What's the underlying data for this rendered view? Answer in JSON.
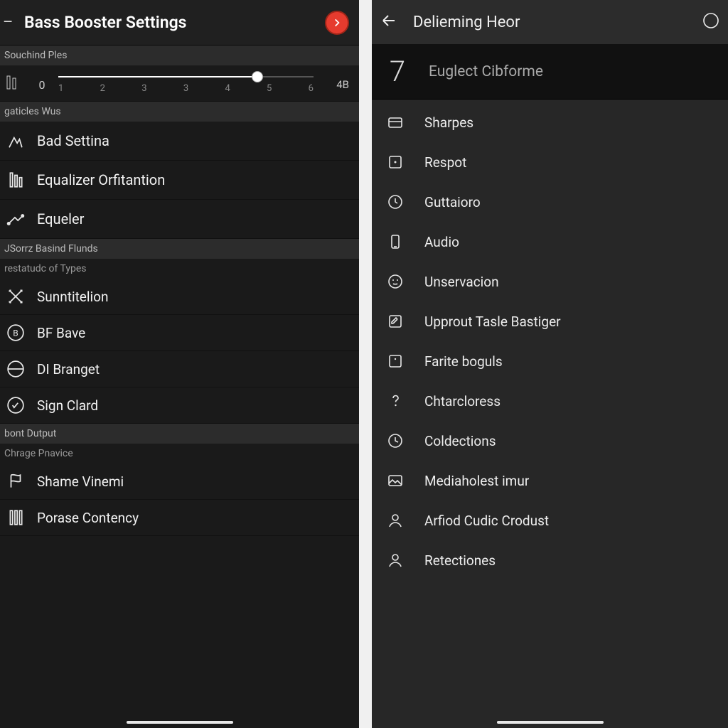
{
  "left": {
    "title": "Bass Booster Settings",
    "section1": "Souchind Ples",
    "slider": {
      "min": "0",
      "end": "4B",
      "ticks": [
        "1",
        "2",
        "3",
        "3",
        "4",
        "5",
        "6"
      ],
      "fill_pct": 78
    },
    "section2": "gaticles Wus",
    "items2": [
      {
        "label": "Bad Settina"
      },
      {
        "label": "Equalizer Orfitantion"
      },
      {
        "label": "Equeler"
      }
    ],
    "section3": "JSorrz Basind Flunds",
    "sub3": "restatudc of Types",
    "items3": [
      {
        "label": "Sunntitelion"
      },
      {
        "label": "BF Bave"
      },
      {
        "label": "DI Branget"
      },
      {
        "label": "Sign Clard"
      }
    ],
    "section4": "bont Dutput",
    "sub4": "Chrage Pnavice",
    "items4": [
      {
        "label": "Shame Vinemi"
      },
      {
        "label": "Porase Contency"
      }
    ]
  },
  "right": {
    "title": "Delieming Heor",
    "big_num": "7",
    "big_label": "Euglect Cibforme",
    "items": [
      {
        "label": "Sharpes",
        "icon": "card"
      },
      {
        "label": "Respot",
        "icon": "box-dot"
      },
      {
        "label": "Guttaioro",
        "icon": "clock-arrow"
      },
      {
        "label": "Audio",
        "icon": "phone"
      },
      {
        "label": "Unservacion",
        "icon": "face"
      },
      {
        "label": "Upprout Tasle Bastiger",
        "icon": "edit"
      },
      {
        "label": "Farite boguls",
        "icon": "box-dot2"
      },
      {
        "label": "Chtarcloress",
        "icon": "question"
      },
      {
        "label": "Coldections",
        "icon": "clock"
      },
      {
        "label": "Mediaholest imur",
        "icon": "image"
      },
      {
        "label": "Arfiod Cudic Crodust",
        "icon": "person"
      },
      {
        "label": "Retectiones",
        "icon": "person"
      }
    ]
  }
}
